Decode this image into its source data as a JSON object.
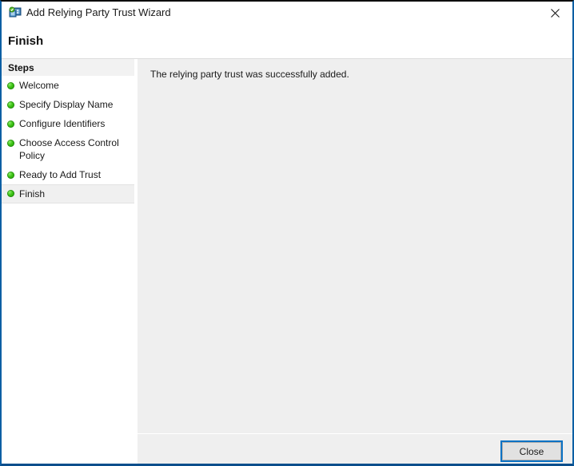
{
  "window": {
    "title": "Add Relying Party Trust Wizard",
    "icon": "wizard-app-icon",
    "close_icon": "close-icon",
    "accent_color": "#0b5fa4"
  },
  "header": {
    "page_title": "Finish"
  },
  "sidebar": {
    "header_label": "Steps",
    "items": [
      {
        "label": "Welcome",
        "state": "done"
      },
      {
        "label": "Specify Display Name",
        "state": "done"
      },
      {
        "label": "Configure Identifiers",
        "state": "done"
      },
      {
        "label": "Choose Access Control Policy",
        "state": "done"
      },
      {
        "label": "Ready to Add Trust",
        "state": "done"
      },
      {
        "label": "Finish",
        "state": "current"
      }
    ],
    "bullet_color": "#3fc316"
  },
  "content": {
    "message": "The relying party trust was successfully added."
  },
  "footer": {
    "close_label": "Close",
    "focus_color": "#0b72c4"
  }
}
